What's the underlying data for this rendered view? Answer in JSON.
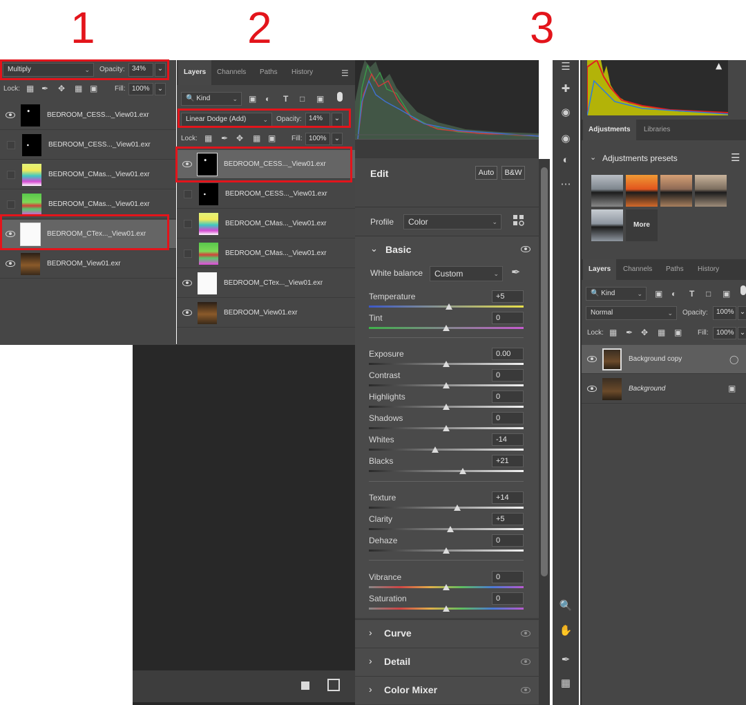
{
  "labels": {
    "one": "1",
    "two": "2",
    "three": "3"
  },
  "panel1": {
    "blend_mode": "Multiply",
    "opacity_label": "Opacity:",
    "opacity_value": "34%",
    "lock_label": "Lock:",
    "fill_label": "Fill:",
    "fill_value": "100%",
    "layers": [
      {
        "name": "BEDROOM_CESS..._View01.exr",
        "visible": true,
        "thumb": "black-dots"
      },
      {
        "name": "BEDROOM_CESS..._View01.exr",
        "visible": false,
        "thumb": "black"
      },
      {
        "name": "BEDROOM_CMas..._View01.exr",
        "visible": false,
        "thumb": "mask-a"
      },
      {
        "name": "BEDROOM_CMas..._View01.exr",
        "visible": false,
        "thumb": "mask-b"
      },
      {
        "name": "BEDROOM_CTex..._View01.exr",
        "visible": true,
        "thumb": "white",
        "selected": true
      },
      {
        "name": "BEDROOM_View01.exr",
        "visible": true,
        "thumb": "render"
      }
    ]
  },
  "panel2": {
    "tabs": [
      "Layers",
      "Channels",
      "Paths",
      "History"
    ],
    "active_tab": "Layers",
    "filter_kind": "Kind",
    "blend_mode": "Linear Dodge (Add)",
    "opacity_label": "Opacity:",
    "opacity_value": "14%",
    "lock_label": "Lock:",
    "fill_label": "Fill:",
    "fill_value": "100%",
    "layers": [
      {
        "name": "BEDROOM_CESS..._View01.exr",
        "visible": true,
        "thumb": "black-dots",
        "selected": true
      },
      {
        "name": "BEDROOM_CESS..._View01.exr",
        "visible": false,
        "thumb": "black"
      },
      {
        "name": "BEDROOM_CMas..._View01.exr",
        "visible": false,
        "thumb": "mask-a"
      },
      {
        "name": "BEDROOM_CMas..._View01.exr",
        "visible": false,
        "thumb": "mask-b"
      },
      {
        "name": "BEDROOM_CTex..._View01.exr",
        "visible": true,
        "thumb": "white"
      },
      {
        "name": "BEDROOM_View01.exr",
        "visible": true,
        "thumb": "render"
      }
    ]
  },
  "camera_raw": {
    "edit_title": "Edit",
    "auto_button": "Auto",
    "bw_button": "B&W",
    "profile_label": "Profile",
    "profile_value": "Color",
    "basic_title": "Basic",
    "white_balance_label": "White balance",
    "white_balance_value": "Custom",
    "sliders": [
      {
        "label": "Temperature",
        "value": "+5",
        "pos": 0.52,
        "track": "temp"
      },
      {
        "label": "Tint",
        "value": "0",
        "pos": 0.5,
        "track": "tint"
      },
      {
        "label": "Exposure",
        "value": "0.00",
        "pos": 0.5,
        "track": "gray"
      },
      {
        "label": "Contrast",
        "value": "0",
        "pos": 0.5,
        "track": "gray"
      },
      {
        "label": "Highlights",
        "value": "0",
        "pos": 0.5,
        "track": "gray"
      },
      {
        "label": "Shadows",
        "value": "0",
        "pos": 0.5,
        "track": "gray"
      },
      {
        "label": "Whites",
        "value": "-14",
        "pos": 0.43,
        "track": "gray"
      },
      {
        "label": "Blacks",
        "value": "+21",
        "pos": 0.605,
        "track": "gray"
      },
      {
        "label": "Texture",
        "value": "+14",
        "pos": 0.57,
        "track": "gray"
      },
      {
        "label": "Clarity",
        "value": "+5",
        "pos": 0.525,
        "track": "gray"
      },
      {
        "label": "Dehaze",
        "value": "0",
        "pos": 0.5,
        "track": "gray"
      },
      {
        "label": "Vibrance",
        "value": "0",
        "pos": 0.5,
        "track": "color"
      },
      {
        "label": "Saturation",
        "value": "0",
        "pos": 0.5,
        "track": "color"
      }
    ],
    "sections": [
      "Curve",
      "Detail",
      "Color Mixer"
    ]
  },
  "panel3": {
    "adj_tabs": [
      "Adjustments",
      "Libraries"
    ],
    "presets_title": "Adjustments presets",
    "more_label": "More",
    "layer_tabs": [
      "Layers",
      "Channels",
      "Paths",
      "History"
    ],
    "filter_kind": "Kind",
    "blend_mode": "Normal",
    "opacity_label": "Opacity:",
    "opacity_value": "100%",
    "lock_label": "Lock:",
    "fill_label": "Fill:",
    "fill_value": "100%",
    "layers": [
      {
        "name": "Background copy",
        "visible": true,
        "selected": true
      },
      {
        "name": "Background",
        "visible": true,
        "italic": true,
        "locked": true
      }
    ]
  },
  "colors": {
    "highlight": "#e3141b",
    "panel": "#474747",
    "selected_row": "#656565"
  }
}
